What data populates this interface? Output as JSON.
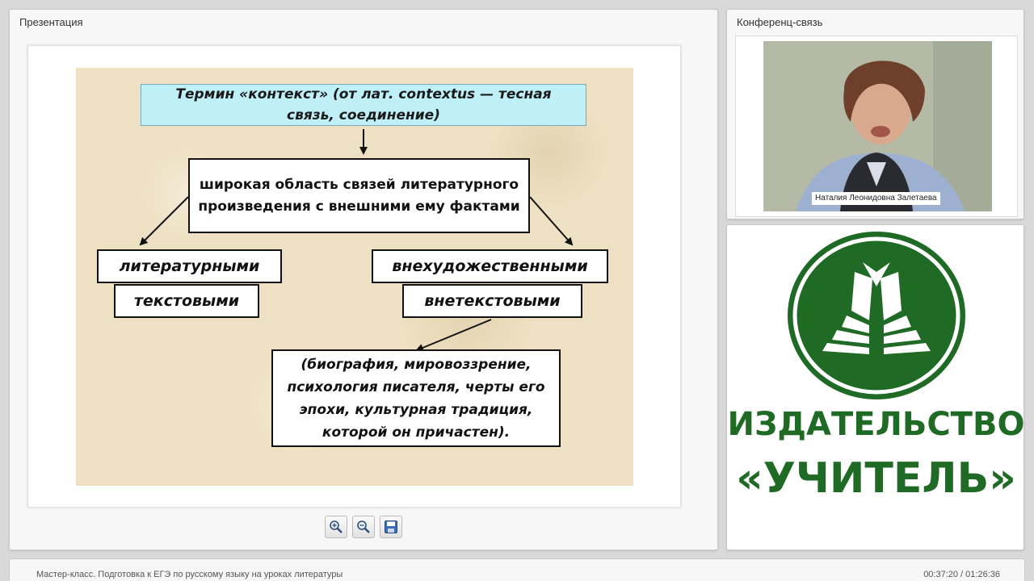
{
  "presentation_panel": {
    "title": "Презентация"
  },
  "slide": {
    "term": "Термин «контекст» (от лат. contextus — тесная связь, соединение)",
    "wide_area": "широкая область связей литературного произведения с внешними ему фактами",
    "literary": "литературными",
    "textual": "текстовыми",
    "non_artistic": "внехудожественными",
    "extratextual": "внетекстовыми",
    "details": "(биография, мировоззрение, психология писателя, черты его эпохи, культурная традиция, которой он причастен)."
  },
  "toolbar": {
    "zoom_in_icon": "zoom-in-icon",
    "zoom_out_icon": "zoom-out-icon",
    "save_icon": "save-icon"
  },
  "conference_panel": {
    "title": "Конференц-связь",
    "speaker_name": "Наталия Леонидовна Залетаева"
  },
  "publisher": {
    "line1": "ИЗДАТЕЛЬСТВО",
    "line2": "«УЧИТЕЛЬ»",
    "brand_color": "#1f6a24"
  },
  "footer": {
    "course_title": "Мастер-класс. Подготовка к ЕГЭ по русскому языку на уроках литературы",
    "timecode": "00:37:20 / 01:26:36"
  }
}
